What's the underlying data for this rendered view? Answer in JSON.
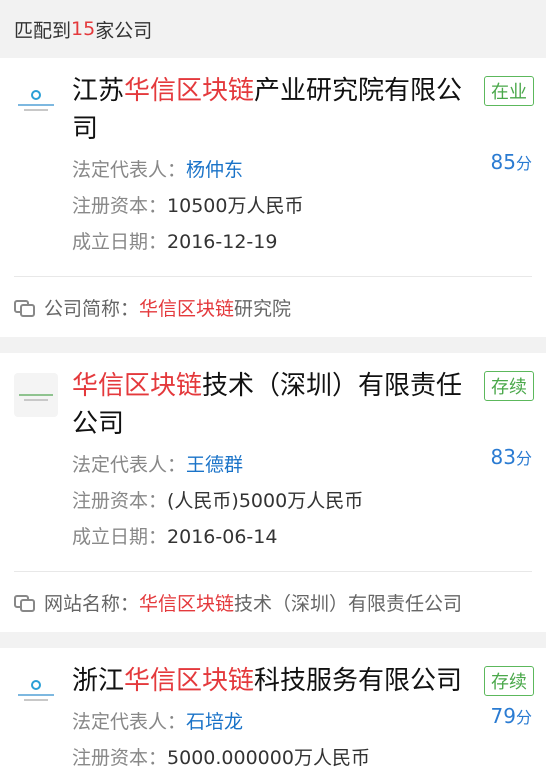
{
  "header": {
    "prefix": "匹配到",
    "count": "15",
    "suffix": "家公司"
  },
  "companies": [
    {
      "name_pre": "江苏",
      "name_hl": "华信区块链",
      "name_post": "产业研究院有限公司",
      "status": "在业",
      "rep_label": "法定代表人：",
      "rep": "杨仲东",
      "score": "85",
      "score_unit": "分",
      "cap_label": "注册资本：",
      "cap": "10500万人民币",
      "date_label": "成立日期：",
      "date": "2016-12-19",
      "extra_label": "公司简称：",
      "extra_hl": "华信区块链",
      "extra_post": "研究院"
    },
    {
      "name_pre": "",
      "name_hl": "华信区块链",
      "name_post": "技术（深圳）有限责任公司",
      "status": "存续",
      "rep_label": "法定代表人：",
      "rep": "王德群",
      "score": "83",
      "score_unit": "分",
      "cap_label": "注册资本：",
      "cap": "(人民币)5000万人民币",
      "date_label": "成立日期：",
      "date": "2016-06-14",
      "extra_label": "网站名称：",
      "extra_hl": "华信区块链",
      "extra_post": "技术（深圳）有限责任公司"
    },
    {
      "name_pre": "浙江",
      "name_hl": "华信区块链",
      "name_post": "科技服务有限公司",
      "status": "存续",
      "rep_label": "法定代表人：",
      "rep": "石培龙",
      "score": "79",
      "score_unit": "分",
      "cap_label": "注册资本：",
      "cap": "5000.000000万人民币"
    }
  ]
}
